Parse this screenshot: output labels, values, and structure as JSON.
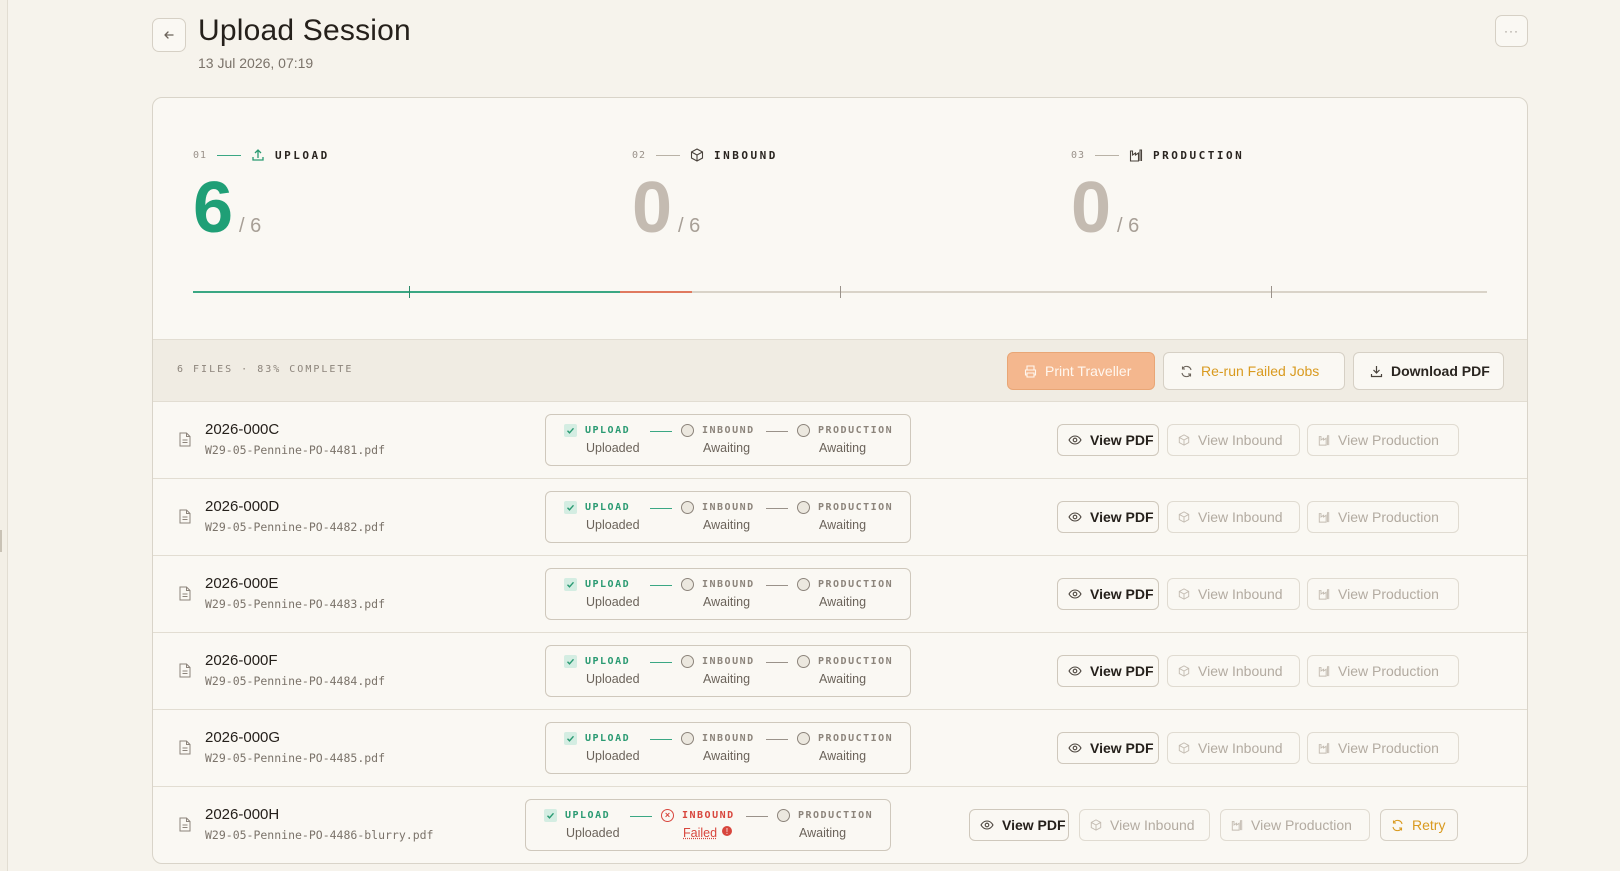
{
  "header": {
    "title": "Upload Session",
    "subtitle": "13 Jul 2026, 07:19",
    "back_icon": "arrow-left-icon",
    "more_icon": "more-icon"
  },
  "stages": [
    {
      "num": "01",
      "name": "UPLOAD",
      "count": "6",
      "total": "/ 6",
      "icon": "upload-icon",
      "color": "#1f9f76"
    },
    {
      "num": "02",
      "name": "INBOUND",
      "count": "0",
      "total": "/ 6",
      "icon": "box-icon"
    },
    {
      "num": "03",
      "name": "PRODUCTION",
      "count": "0",
      "total": "/ 6",
      "icon": "factory-icon"
    }
  ],
  "progress": {
    "complete_fraction": 0.33,
    "failed_fraction": 0.056
  },
  "toolbar": {
    "summary": "6 FILES · 83% COMPLETE",
    "print_label": "Print Traveller",
    "rerun_label": "Re-run Failed Jobs",
    "download_label": "Download PDF"
  },
  "pipeline_labels": {
    "upload": "UPLOAD",
    "inbound": "INBOUND",
    "production": "PRODUCTION"
  },
  "actions": {
    "view_pdf": "View PDF",
    "view_inbound": "View Inbound",
    "view_production": "View Production",
    "retry": "Retry"
  },
  "files": [
    {
      "id": "2026-000C",
      "filename": "W29-05-Pennine-PO-4481.pdf",
      "upload": "Uploaded",
      "inbound": "Awaiting",
      "production": "Awaiting"
    },
    {
      "id": "2026-000D",
      "filename": "W29-05-Pennine-PO-4482.pdf",
      "upload": "Uploaded",
      "inbound": "Awaiting",
      "production": "Awaiting"
    },
    {
      "id": "2026-000E",
      "filename": "W29-05-Pennine-PO-4483.pdf",
      "upload": "Uploaded",
      "inbound": "Awaiting",
      "production": "Awaiting"
    },
    {
      "id": "2026-000F",
      "filename": "W29-05-Pennine-PO-4484.pdf",
      "upload": "Uploaded",
      "inbound": "Awaiting",
      "production": "Awaiting"
    },
    {
      "id": "2026-000G",
      "filename": "W29-05-Pennine-PO-4485.pdf",
      "upload": "Uploaded",
      "inbound": "Awaiting",
      "production": "Awaiting"
    },
    {
      "id": "2026-000H",
      "filename": "W29-05-Pennine-PO-4486-blurry.pdf",
      "upload": "Uploaded",
      "inbound": "Failed",
      "production": "Awaiting",
      "failed": true
    }
  ],
  "colors": {
    "accent_green": "#1f9f76",
    "fail_red": "#d8463d",
    "warn_amber": "#d99a1f",
    "print_orange": "#f4b78e"
  }
}
